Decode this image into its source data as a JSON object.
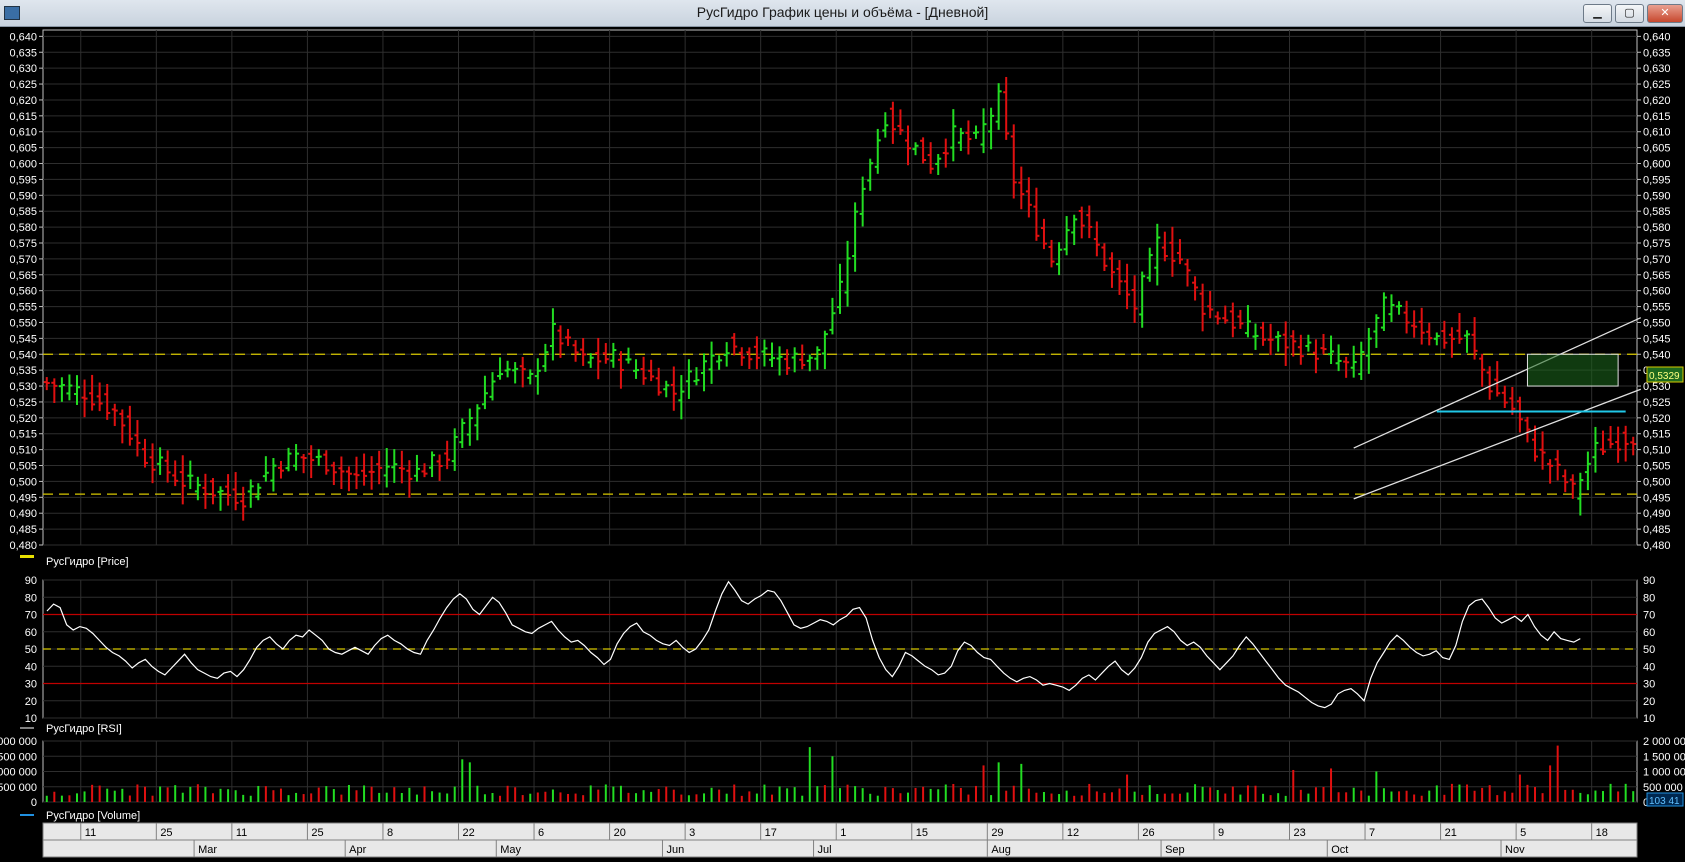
{
  "window": {
    "title": "РусГидро График цены и объёма - [Дневной]",
    "minimize_icon": "minimize-icon",
    "maximize_icon": "maximize-icon",
    "close_icon": "close-icon"
  },
  "legends": {
    "price": "РусГидро [Price]",
    "rsi": "РусГидро [RSI]",
    "volume": "РусГидро [Volume]"
  },
  "price_badge": "0,5329",
  "volume_badge": "103 41",
  "colors": {
    "up": "#22dd22",
    "down": "#e01010",
    "grid": "#2e2e2e",
    "level": "#d8c800",
    "rsi_band": "#c00000",
    "cyan": "#20c8e8",
    "box": "#1e6a1e"
  },
  "chart_data": [
    {
      "type": "bar",
      "name": "price",
      "ylim": [
        0.48,
        0.642
      ],
      "y_ticks": [
        "0,480",
        "0,485",
        "0,490",
        "0,495",
        "0,500",
        "0,505",
        "0,510",
        "0,515",
        "0,520",
        "0,525",
        "0,530",
        "0,535",
        "0,540",
        "0,545",
        "0,550",
        "0,555",
        "0,560",
        "0,565",
        "0,570",
        "0,575",
        "0,580",
        "0,585",
        "0,590",
        "0,595",
        "0,600",
        "0,605",
        "0,610",
        "0,615",
        "0,620",
        "0,625",
        "0,630",
        "0,635",
        "0,640"
      ],
      "levels": [
        0.54,
        0.496
      ],
      "bars_count": 211,
      "anchors_close": [
        [
          0,
          0.531
        ],
        [
          5,
          0.528
        ],
        [
          9,
          0.522
        ],
        [
          13,
          0.508
        ],
        [
          18,
          0.5
        ],
        [
          22,
          0.497
        ],
        [
          26,
          0.495
        ],
        [
          30,
          0.505
        ],
        [
          33,
          0.508
        ],
        [
          37,
          0.506
        ],
        [
          41,
          0.501
        ],
        [
          45,
          0.505
        ],
        [
          49,
          0.503
        ],
        [
          53,
          0.508
        ],
        [
          56,
          0.52
        ],
        [
          60,
          0.536
        ],
        [
          64,
          0.532
        ],
        [
          67,
          0.547
        ],
        [
          71,
          0.538
        ],
        [
          75,
          0.539
        ],
        [
          79,
          0.534
        ],
        [
          83,
          0.528
        ],
        [
          87,
          0.537
        ],
        [
          90,
          0.543
        ],
        [
          94,
          0.54
        ],
        [
          98,
          0.538
        ],
        [
          102,
          0.54
        ],
        [
          105,
          0.56
        ],
        [
          108,
          0.594
        ],
        [
          111,
          0.615
        ],
        [
          114,
          0.607
        ],
        [
          117,
          0.6
        ],
        [
          120,
          0.609
        ],
        [
          123,
          0.607
        ],
        [
          126,
          0.62
        ],
        [
          128,
          0.595
        ],
        [
          131,
          0.58
        ],
        [
          133,
          0.57
        ],
        [
          136,
          0.585
        ],
        [
          138,
          0.578
        ],
        [
          141,
          0.565
        ],
        [
          144,
          0.555
        ],
        [
          147,
          0.575
        ],
        [
          150,
          0.57
        ],
        [
          153,
          0.555
        ],
        [
          157,
          0.55
        ],
        [
          161,
          0.545
        ],
        [
          165,
          0.543
        ],
        [
          169,
          0.54
        ],
        [
          173,
          0.535
        ],
        [
          177,
          0.555
        ],
        [
          181,
          0.55
        ],
        [
          184,
          0.545
        ],
        [
          188,
          0.545
        ],
        [
          191,
          0.53
        ],
        [
          194,
          0.523
        ],
        [
          197,
          0.51
        ],
        [
          200,
          0.503
        ],
        [
          202,
          0.497
        ],
        [
          205,
          0.51
        ],
        [
          208,
          0.513
        ],
        [
          211,
          0.515
        ]
      ],
      "anchors_close_b": [
        [
          0,
          0.515
        ],
        [
          4,
          0.513
        ],
        [
          6,
          0.512
        ],
        [
          9,
          0.508
        ],
        [
          12,
          0.512
        ],
        [
          14,
          0.522
        ],
        [
          17,
          0.536
        ],
        [
          20,
          0.533
        ],
        [
          23,
          0.534
        ],
        [
          26,
          0.533
        ],
        [
          29,
          0.528
        ],
        [
          31,
          0.536
        ],
        [
          34,
          0.534
        ],
        [
          37,
          0.531
        ]
      ],
      "channel": {
        "upper": [
          [
            0.5105,
            173
          ],
          [
            0.5515,
            211
          ]
        ],
        "lower": [
          [
            0.4945,
            173
          ],
          [
            0.529,
            211
          ]
        ]
      },
      "cyan_levels": [
        0.522
      ],
      "consolidation_box": [
        0.53,
        0.54
      ]
    },
    {
      "type": "line",
      "name": "rsi",
      "ylim": [
        10,
        90
      ],
      "y_ticks": [
        "10",
        "20",
        "30",
        "40",
        "50",
        "60",
        "70",
        "80",
        "90"
      ],
      "bands": [
        30,
        70
      ],
      "midline": 50,
      "values": [
        72,
        76,
        74,
        64,
        61,
        63,
        62,
        59,
        55,
        51,
        48,
        46,
        43,
        39,
        42,
        44,
        40,
        37,
        35,
        39,
        43,
        47,
        42,
        38,
        36,
        34,
        33,
        36,
        37,
        34,
        38,
        44,
        51,
        55,
        57,
        53,
        50,
        55,
        58,
        57,
        61,
        58,
        55,
        50,
        48,
        47,
        49,
        51,
        49,
        47,
        52,
        56,
        58,
        55,
        53,
        50,
        48,
        47,
        55,
        61,
        68,
        74,
        79,
        82,
        79,
        73,
        70,
        75,
        80,
        77,
        71,
        64,
        62,
        60,
        59,
        62,
        64,
        66,
        61,
        57,
        54,
        55,
        52,
        48,
        45,
        41,
        44,
        53,
        59,
        63,
        65,
        60,
        58,
        55,
        53,
        52,
        55,
        51,
        48,
        50,
        55,
        61,
        72,
        82,
        89,
        84,
        78,
        76,
        79,
        81,
        84,
        83,
        78,
        71,
        64,
        62,
        63,
        65,
        67,
        66,
        64,
        67,
        69,
        73,
        74,
        68,
        55,
        45,
        38,
        34,
        40,
        48,
        46,
        43,
        40,
        38,
        35,
        36,
        40,
        49,
        54,
        52,
        48,
        45,
        44,
        40,
        36,
        33,
        31,
        33,
        34,
        32,
        29,
        30,
        29,
        28,
        26,
        29,
        33,
        35,
        32,
        36,
        40,
        43,
        38,
        35,
        39,
        45,
        54,
        59,
        61,
        63,
        60,
        55,
        52,
        54,
        51,
        46,
        42,
        38,
        42,
        46,
        52,
        57,
        53,
        48,
        43,
        38,
        33,
        29,
        27,
        25,
        22,
        19,
        17,
        16,
        18,
        24,
        26,
        27,
        24,
        20,
        33,
        42,
        48,
        54,
        58,
        55,
        51,
        48,
        46,
        47,
        49,
        45,
        44,
        52,
        66,
        75,
        78,
        79,
        74,
        68,
        65,
        67,
        69,
        66,
        70,
        63,
        58,
        55,
        60,
        56,
        55,
        54,
        56
      ]
    },
    {
      "type": "bar",
      "name": "volume",
      "ylim": [
        0,
        2000000
      ],
      "y_ticks": [
        "0",
        "500 000",
        "1 000 000",
        "1 500 000",
        "2 000 000"
      ],
      "spikes": [
        [
          55,
          1400000
        ],
        [
          56,
          1300000
        ],
        [
          101,
          1800000
        ],
        [
          104,
          1500000
        ],
        [
          124,
          1200000
        ],
        [
          126,
          1300000
        ],
        [
          129,
          1250000
        ],
        [
          143,
          900000
        ],
        [
          165,
          1050000
        ],
        [
          170,
          1100000
        ],
        [
          176,
          1000000
        ],
        [
          195,
          900000
        ],
        [
          199,
          1200000
        ],
        [
          200,
          1850000
        ]
      ]
    }
  ],
  "x_axis": {
    "day_labels": [
      [
        5,
        "11"
      ],
      [
        15,
        "25"
      ],
      [
        25,
        "11"
      ],
      [
        35,
        "25"
      ],
      [
        45,
        "8"
      ],
      [
        55,
        "22"
      ],
      [
        65,
        "6"
      ],
      [
        75,
        "20"
      ],
      [
        85,
        "3"
      ],
      [
        95,
        "17"
      ],
      [
        105,
        "1"
      ],
      [
        115,
        "15"
      ],
      [
        125,
        "29"
      ],
      [
        135,
        "12"
      ],
      [
        145,
        "26"
      ],
      [
        155,
        "9"
      ],
      [
        165,
        "23"
      ],
      [
        175,
        "7"
      ],
      [
        185,
        "21"
      ],
      [
        195,
        "5"
      ],
      [
        205,
        "18"
      ]
    ],
    "month_labels": [
      [
        20,
        "Mar"
      ],
      [
        40,
        "Apr"
      ],
      [
        60,
        "May"
      ],
      [
        82,
        "Jun"
      ],
      [
        102,
        "Jul"
      ],
      [
        125,
        "Aug"
      ],
      [
        148,
        "Sep"
      ],
      [
        170,
        "Oct"
      ],
      [
        193,
        "Nov"
      ]
    ]
  }
}
